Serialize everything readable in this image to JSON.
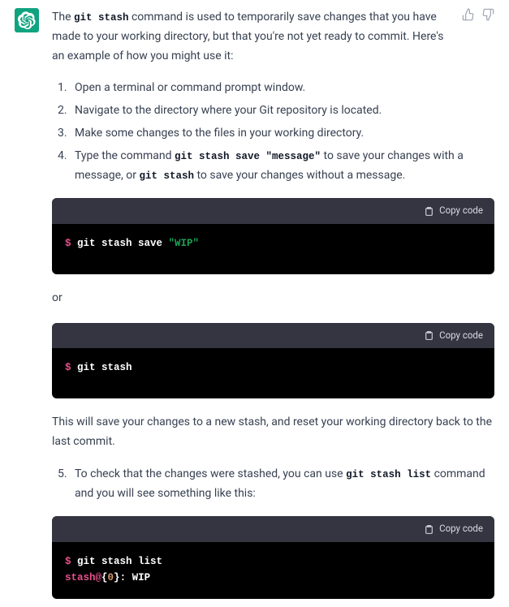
{
  "intro": {
    "pre": "The ",
    "code": "git stash",
    "post": " command is used to temporarily save changes that you have made to your working directory, but that you're not yet ready to commit. Here's an example of how you might use it:"
  },
  "steps_a": [
    "Open a terminal or command prompt window.",
    "Navigate to the directory where your Git repository is located.",
    "Make some changes to the files in your working directory."
  ],
  "step4": {
    "pre": "Type the command ",
    "code1": "git stash save \"message\"",
    "mid": " to save your changes with a message, or ",
    "code2": "git stash",
    "post": " to save your changes without a message."
  },
  "copy_label": "Copy code",
  "code1": {
    "prompt": "$ ",
    "cmd": "git stash save ",
    "str": "\"WIP\""
  },
  "or_text": "or",
  "code2": {
    "prompt": "$ ",
    "cmd": "git stash"
  },
  "para2": "This will save your changes to a new stash, and reset your working directory back to the last commit.",
  "step5": {
    "pre": "To check that the changes were stashed, you can use ",
    "code": "git stash list",
    "post": " command and you will see something like this:"
  },
  "code3": {
    "prompt1": "$ ",
    "cmd1": "git stash list",
    "ref_pre": "stash@",
    "ref_brace_open": "{",
    "ref_num": "0",
    "ref_brace_close": "}",
    "tail": ": WIP"
  }
}
